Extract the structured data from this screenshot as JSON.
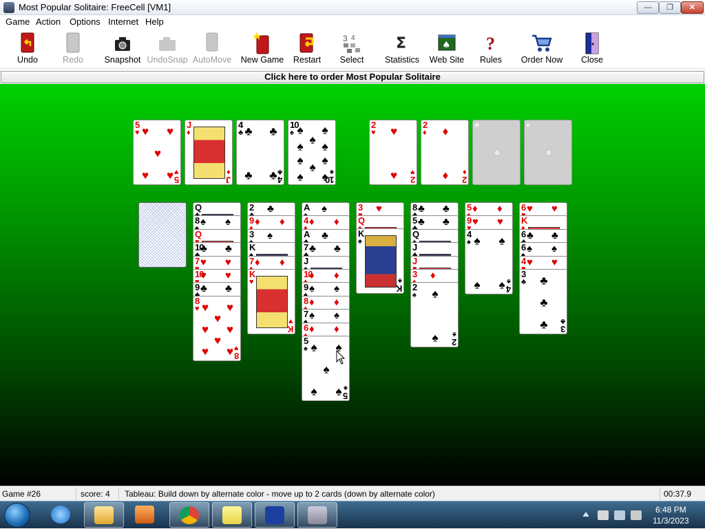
{
  "window": {
    "title": "Most Popular Solitaire: FreeCell [VM1]",
    "min": "—",
    "max": "❐",
    "close": "✕"
  },
  "menu": [
    "Game",
    "Action",
    "Options",
    "Internet",
    "Help"
  ],
  "toolbar": [
    {
      "label": "Undo",
      "icon": "undo-icon",
      "enabled": true
    },
    {
      "label": "Redo",
      "icon": "redo-icon",
      "enabled": false
    },
    {
      "label": "Snapshot",
      "icon": "camera-icon",
      "enabled": true
    },
    {
      "label": "UndoSnap",
      "icon": "undo-snapshot-icon",
      "enabled": false
    },
    {
      "label": "AutoMove",
      "icon": "automove-icon",
      "enabled": false
    },
    {
      "label": "New Game",
      "icon": "new-game-icon",
      "enabled": true
    },
    {
      "label": "Restart",
      "icon": "restart-icon",
      "enabled": true
    },
    {
      "label": "Select",
      "icon": "select-game-icon",
      "enabled": true
    },
    {
      "label": "Statistics",
      "icon": "sigma-icon",
      "enabled": true
    },
    {
      "label": "Web Site",
      "icon": "web-site-icon",
      "enabled": true
    },
    {
      "label": "Rules",
      "icon": "question-icon",
      "enabled": true
    },
    {
      "label": "Order Now",
      "icon": "shopping-cart-icon",
      "enabled": true
    },
    {
      "label": "Close",
      "icon": "close-door-icon",
      "enabled": true
    }
  ],
  "order_banner": "Click here to order Most Popular Solitaire",
  "freecells": [
    {
      "rank": "5",
      "suit": "♥"
    },
    {
      "rank": "J",
      "suit": "♦"
    },
    {
      "rank": "4",
      "suit": "♣"
    },
    {
      "rank": "10",
      "suit": "♠"
    }
  ],
  "foundations": [
    {
      "rank": "2",
      "suit": "♥"
    },
    {
      "rank": "2",
      "suit": "♦"
    },
    {
      "rank": "",
      "suit": "♣",
      "empty": true
    },
    {
      "rank": "",
      "suit": "♠",
      "empty": true
    }
  ],
  "tableau": [
    {
      "facedown": true,
      "cards": []
    },
    {
      "cards": [
        [
          "Q",
          "♣"
        ],
        [
          "8",
          "♠"
        ],
        [
          "Q",
          "♥"
        ],
        [
          "10",
          "♣"
        ],
        [
          "7",
          "♥"
        ],
        [
          "10",
          "♥"
        ],
        [
          "9",
          "♣"
        ],
        [
          "8",
          "♥"
        ]
      ]
    },
    {
      "cards": [
        [
          "2",
          "♣"
        ],
        [
          "9",
          "♦"
        ],
        [
          "3",
          "♠"
        ],
        [
          "K",
          "♠"
        ],
        [
          "7",
          "♦"
        ],
        [
          "K",
          "♥"
        ]
      ]
    },
    {
      "cards": [
        [
          "A",
          "♠"
        ],
        [
          "4",
          "♦"
        ],
        [
          "A",
          "♣"
        ],
        [
          "7",
          "♣"
        ],
        [
          "J",
          "♠"
        ],
        [
          "10",
          "♦"
        ],
        [
          "9",
          "♠"
        ],
        [
          "8",
          "♦"
        ],
        [
          "7",
          "♠"
        ],
        [
          "6",
          "♦"
        ],
        [
          "5",
          "♠"
        ]
      ]
    },
    {
      "cards": [
        [
          "3",
          "♥"
        ],
        [
          "Q",
          "♦"
        ],
        [
          "K",
          "♠"
        ]
      ]
    },
    {
      "cards": [
        [
          "8",
          "♣"
        ],
        [
          "5",
          "♣"
        ],
        [
          "Q",
          "♠"
        ],
        [
          "J",
          "♣"
        ],
        [
          "J",
          "♥"
        ],
        [
          "3",
          "♦"
        ],
        [
          "2",
          "♠"
        ]
      ]
    },
    {
      "cards": [
        [
          "5",
          "♦"
        ],
        [
          "9",
          "♥"
        ],
        [
          "4",
          "♠"
        ]
      ]
    },
    {
      "cards": [
        [
          "6",
          "♥"
        ],
        [
          "K",
          "♦"
        ],
        [
          "6",
          "♣"
        ],
        [
          "6",
          "♠"
        ],
        [
          "4",
          "♥"
        ],
        [
          "3",
          "♣"
        ]
      ]
    }
  ],
  "status": {
    "game": "Game #26",
    "score": "score: 4",
    "hint": "Tableau: Build down by alternate color - move up to 2 cards (down by alternate color)",
    "timer": "00:37.9"
  },
  "taskbar": {
    "apps": [
      "internet-explorer-icon",
      "file-explorer-icon",
      "media-player-icon",
      "chrome-icon",
      "sticky-notes-icon",
      "star-app-icon",
      "solitaire-app-icon"
    ],
    "time": "6:48 PM",
    "date": "11/3/2023"
  },
  "colors": {
    "felt_top": "#00d000",
    "felt_bottom": "#000000",
    "red_suit": "#e00000"
  }
}
